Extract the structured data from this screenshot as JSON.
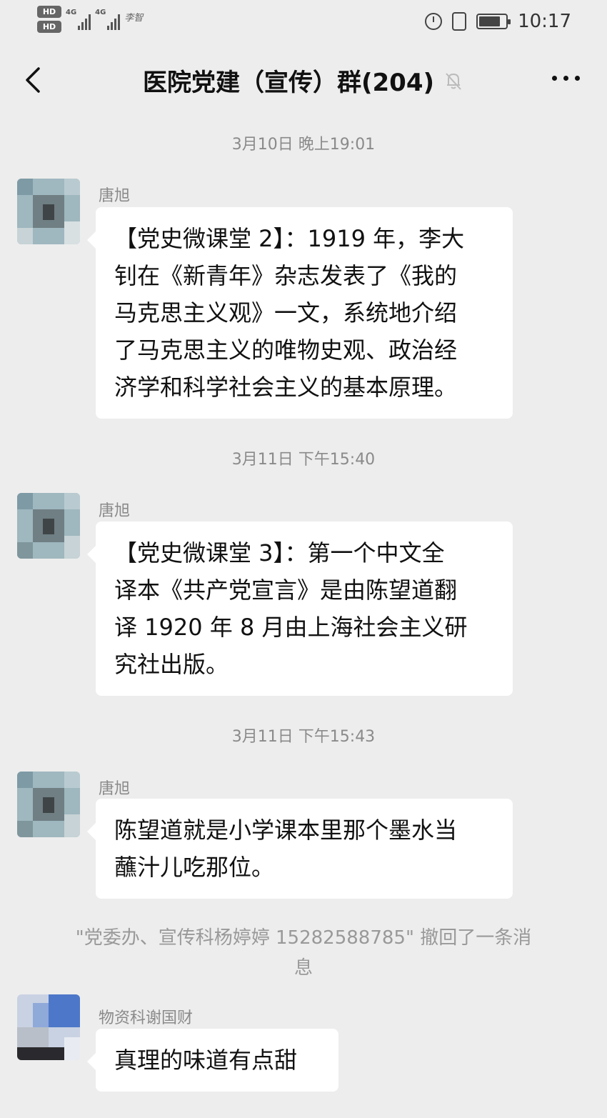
{
  "status_bar": {
    "hd1": "HD",
    "hd2": "HD",
    "net1": "4G",
    "net2": "4G",
    "carrier_extra": "李智",
    "time": "10:17",
    "battery_level": 0.8
  },
  "header": {
    "title": "医院党建（宣传）群(204)",
    "back_icon": "chevron-left-icon",
    "mute_icon": "bell-muted-icon",
    "more_icon": "more-dots-icon"
  },
  "messages": [
    {
      "timestamp": "3月10日 晚上19:01",
      "sender": "唐旭",
      "lines": [
        "【党史微课堂 2】：1919 年，李大",
        "钊在《新青年》杂志发表了《我的",
        "马克思主义观》一文，系统地介绍",
        "了马克思主义的唯物史观、政治经",
        "济学和科学社会主义的基本原理。"
      ]
    },
    {
      "timestamp": "3月11日 下午15:40",
      "sender": "唐旭",
      "lines": [
        "【党史微课堂 3】：第一个中文全",
        "译本《共产党宣言》是由陈望道翻",
        "译 1920 年 8 月由上海社会主义研",
        "究社出版。"
      ]
    },
    {
      "timestamp": "3月11日 下午15:43",
      "sender": "唐旭",
      "lines": [
        "陈望道就是小学课本里那个墨水当",
        "蘸汁儿吃那位。"
      ]
    }
  ],
  "recall_notice": {
    "line1": "\"党委办、宣传科杨婷婷 15282588785\" 撤回了一条消",
    "line2": "息"
  },
  "last_message": {
    "sender": "物资科谢国财",
    "text": "真理的味道有点甜"
  },
  "colors": {
    "background": "#ededed",
    "bubble": "#ffffff",
    "meta_text": "#8a8a8a"
  }
}
